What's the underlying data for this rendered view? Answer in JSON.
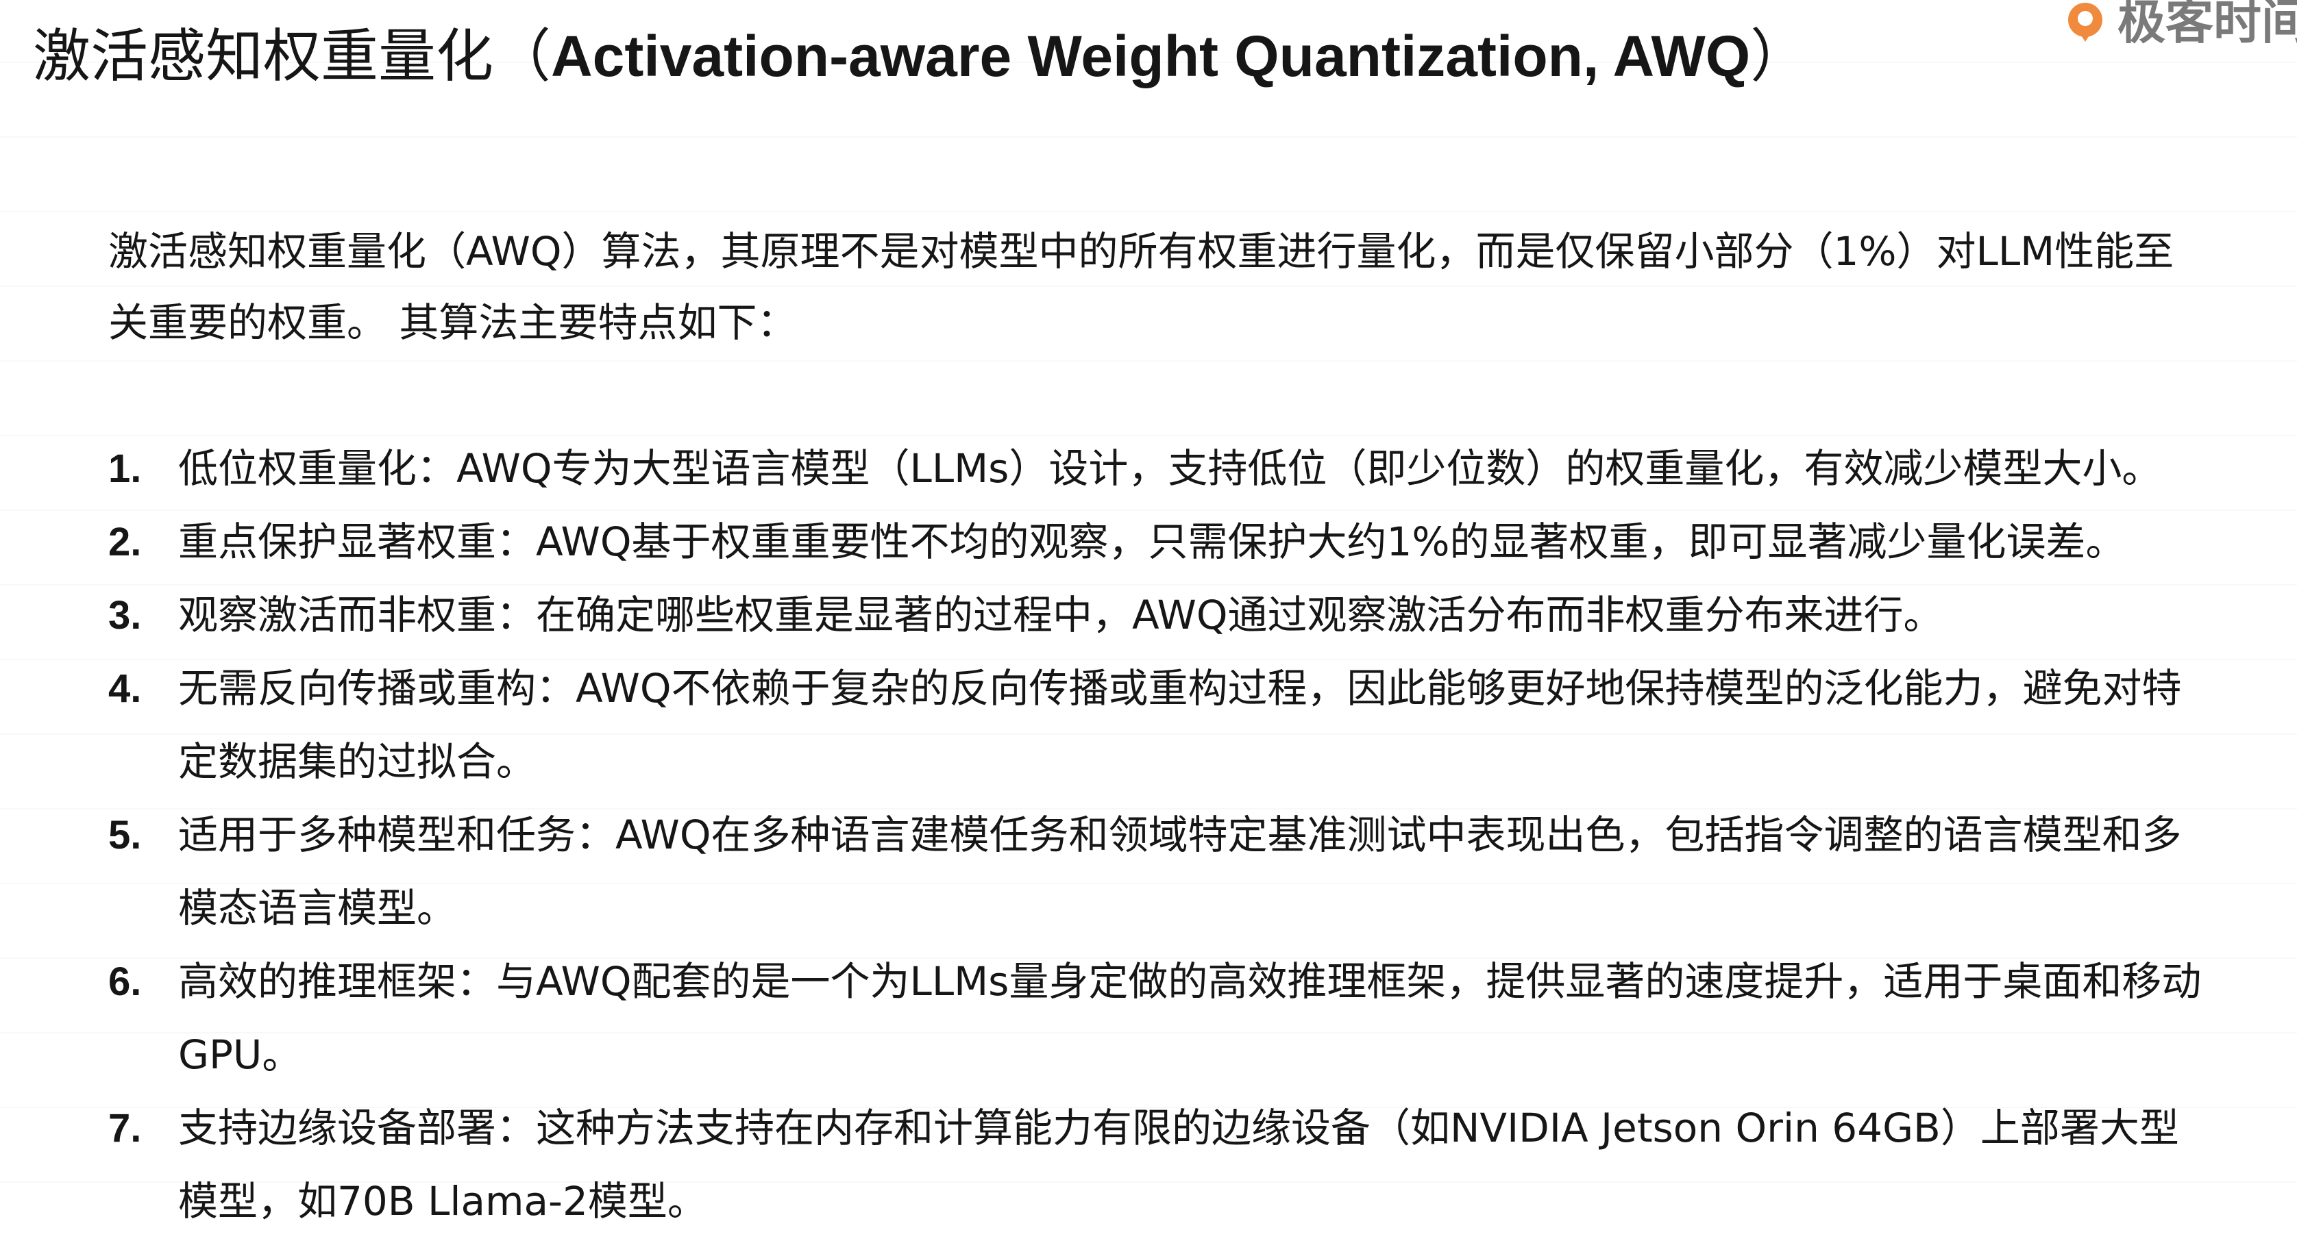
{
  "title": {
    "cn": "激活感知权重量化（",
    "en": "Activation-aware Weight Quantization, AWQ",
    "close": "）"
  },
  "logo": {
    "text": "极客时间",
    "mark_color": "#f08a3c",
    "icon": "geek-logo-icon"
  },
  "intro": {
    "text": "激活感知权重量化（AWQ）算法，其原理不是对模型中的所有权重进行量化，而是仅保留小部分（1%）对LLM性能至关重要的权重。 其算法主要特点如下："
  },
  "items": [
    {
      "num": "1.",
      "text": "低位权重量化：AWQ专为大型语言模型（LLMs）设计，支持低位（即少位数）的权重量化，有效减少模型大小。"
    },
    {
      "num": "2.",
      "text": "重点保护显著权重：AWQ基于权重重要性不均的观察，只需保护大约1%的显著权重，即可显著减少量化误差。"
    },
    {
      "num": "3.",
      "text": "观察激活而非权重：在确定哪些权重是显著的过程中，AWQ通过观察激活分布而非权重分布来进行。"
    },
    {
      "num": "4.",
      "text": "无需反向传播或重构：AWQ不依赖于复杂的反向传播或重构过程，因此能够更好地保持模型的泛化能力，避免对特定数据集的过拟合。"
    },
    {
      "num": "5.",
      "text": "适用于多种模型和任务：AWQ在多种语言建模任务和领域特定基准测试中表现出色，包括指令调整的语言模型和多模态语言模型。"
    },
    {
      "num": "6.",
      "text": "高效的推理框架：与AWQ配套的是一个为LLMs量身定做的高效推理框架，提供显著的速度提升，适用于桌面和移动GPU。"
    },
    {
      "num": "7.",
      "text": "支持边缘设备部署：这种方法支持在内存和计算能力有限的边缘设备（如NVIDIA Jetson Orin 64GB）上部署大型模型，如70B Llama-2模型。"
    }
  ]
}
